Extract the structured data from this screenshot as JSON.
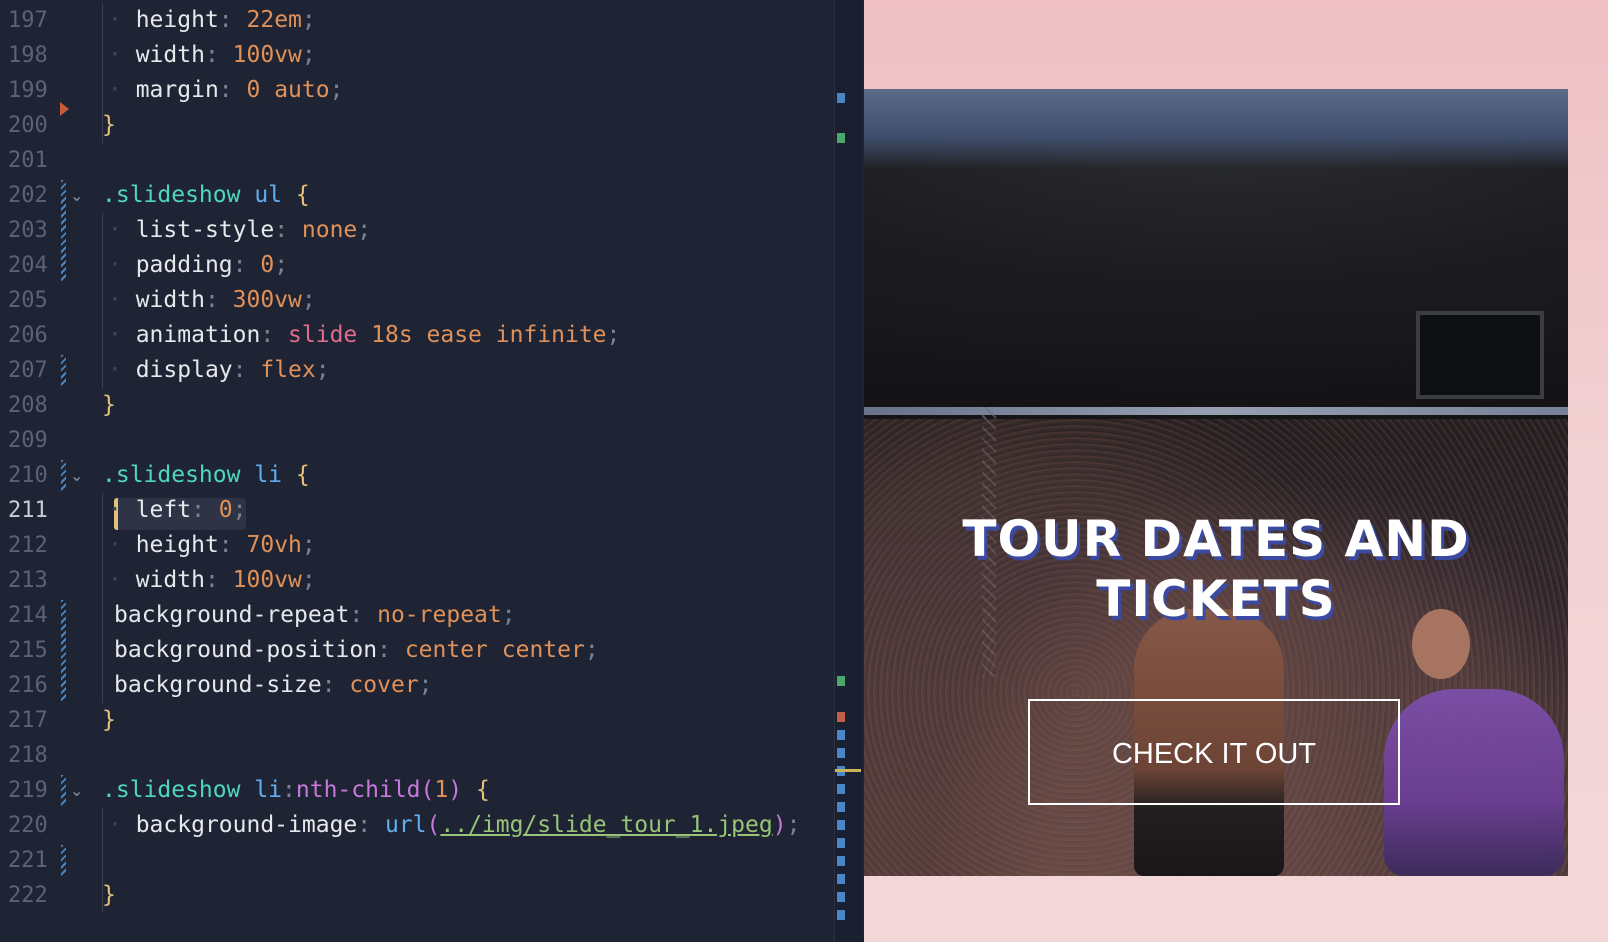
{
  "editor": {
    "lines": [
      {
        "n": "197",
        "tokens": [
          {
            "t": "height",
            "c": "prop"
          },
          {
            "t": ":",
            "c": "punc"
          },
          {
            "t": " 22em",
            "c": "num"
          },
          {
            "t": ";",
            "c": "punc"
          }
        ],
        "indent": 2
      },
      {
        "n": "198",
        "tokens": [
          {
            "t": "width",
            "c": "prop"
          },
          {
            "t": ":",
            "c": "punc"
          },
          {
            "t": " 100vw",
            "c": "num"
          },
          {
            "t": ";",
            "c": "punc"
          }
        ],
        "indent": 2
      },
      {
        "n": "199",
        "tokens": [
          {
            "t": "margin",
            "c": "prop"
          },
          {
            "t": ":",
            "c": "punc"
          },
          {
            "t": " 0 auto",
            "c": "num"
          },
          {
            "t": ";",
            "c": "punc"
          }
        ],
        "indent": 2
      },
      {
        "n": "200",
        "tokens": [
          {
            "t": "}",
            "c": "brace"
          }
        ],
        "indent": 1
      },
      {
        "n": "201",
        "tokens": [],
        "indent": 0
      },
      {
        "n": "202",
        "tokens": [
          {
            "t": ".slideshow",
            "c": "sel"
          },
          {
            "t": " ul",
            "c": "tag"
          },
          {
            "t": " {",
            "c": "brace"
          }
        ],
        "indent": 0,
        "fold": true
      },
      {
        "n": "203",
        "tokens": [
          {
            "t": "list-style",
            "c": "prop"
          },
          {
            "t": ":",
            "c": "punc"
          },
          {
            "t": " none",
            "c": "kw"
          },
          {
            "t": ";",
            "c": "punc"
          }
        ],
        "indent": 2
      },
      {
        "n": "204",
        "tokens": [
          {
            "t": "padding",
            "c": "prop"
          },
          {
            "t": ":",
            "c": "punc"
          },
          {
            "t": " 0",
            "c": "num"
          },
          {
            "t": ";",
            "c": "punc"
          }
        ],
        "indent": 2
      },
      {
        "n": "205",
        "tokens": [
          {
            "t": "width",
            "c": "prop"
          },
          {
            "t": ":",
            "c": "punc"
          },
          {
            "t": " 300vw",
            "c": "num"
          },
          {
            "t": ";",
            "c": "punc"
          }
        ],
        "indent": 2
      },
      {
        "n": "206",
        "tokens": [
          {
            "t": "animation",
            "c": "prop"
          },
          {
            "t": ":",
            "c": "punc"
          },
          {
            "t": " slide",
            "c": "anim"
          },
          {
            "t": " 18s ease infinite",
            "c": "kw"
          },
          {
            "t": ";",
            "c": "punc"
          }
        ],
        "indent": 2
      },
      {
        "n": "207",
        "tokens": [
          {
            "t": "display",
            "c": "prop"
          },
          {
            "t": ":",
            "c": "punc"
          },
          {
            "t": " flex",
            "c": "kw"
          },
          {
            "t": ";",
            "c": "punc"
          }
        ],
        "indent": 2
      },
      {
        "n": "208",
        "tokens": [
          {
            "t": "}",
            "c": "brace"
          }
        ],
        "indent": 1
      },
      {
        "n": "209",
        "tokens": [],
        "indent": 0
      },
      {
        "n": "210",
        "tokens": [
          {
            "t": ".slideshow",
            "c": "sel"
          },
          {
            "t": " li",
            "c": "tag"
          },
          {
            "t": " {",
            "c": "brace"
          }
        ],
        "indent": 0,
        "fold": true
      },
      {
        "n": "211",
        "tokens": [
          {
            "t": "left",
            "c": "prop"
          },
          {
            "t": ":",
            "c": "punc"
          },
          {
            "t": " 0",
            "c": "num"
          },
          {
            "t": ";",
            "c": "punc"
          }
        ],
        "indent": 2,
        "current": true
      },
      {
        "n": "212",
        "tokens": [
          {
            "t": "height",
            "c": "prop"
          },
          {
            "t": ":",
            "c": "punc"
          },
          {
            "t": " 70vh",
            "c": "num"
          },
          {
            "t": ";",
            "c": "punc"
          }
        ],
        "indent": 2
      },
      {
        "n": "213",
        "tokens": [
          {
            "t": "width",
            "c": "prop"
          },
          {
            "t": ":",
            "c": "punc"
          },
          {
            "t": " 100vw",
            "c": "num"
          },
          {
            "t": ";",
            "c": "punc"
          }
        ],
        "indent": 2
      },
      {
        "n": "214",
        "tokens": [
          {
            "t": "background-repeat",
            "c": "prop"
          },
          {
            "t": ":",
            "c": "punc"
          },
          {
            "t": " no-repeat",
            "c": "kw"
          },
          {
            "t": ";",
            "c": "punc"
          }
        ],
        "indent": 1.5
      },
      {
        "n": "215",
        "tokens": [
          {
            "t": "background-position",
            "c": "prop"
          },
          {
            "t": ":",
            "c": "punc"
          },
          {
            "t": " center center",
            "c": "kw"
          },
          {
            "t": ";",
            "c": "punc"
          }
        ],
        "indent": 1.5
      },
      {
        "n": "216",
        "tokens": [
          {
            "t": "background-size",
            "c": "prop"
          },
          {
            "t": ":",
            "c": "punc"
          },
          {
            "t": " cover",
            "c": "kw"
          },
          {
            "t": ";",
            "c": "punc"
          }
        ],
        "indent": 1.5
      },
      {
        "n": "217",
        "tokens": [
          {
            "t": "}",
            "c": "brace"
          }
        ],
        "indent": 1
      },
      {
        "n": "218",
        "tokens": [],
        "indent": 0
      },
      {
        "n": "219",
        "tokens": [
          {
            "t": ".slideshow",
            "c": "sel"
          },
          {
            "t": " li",
            "c": "tag"
          },
          {
            "t": ":",
            "c": "punc"
          },
          {
            "t": "nth-child",
            "c": "pseudo"
          },
          {
            "t": "(",
            "c": "paren"
          },
          {
            "t": "1",
            "c": "num"
          },
          {
            "t": ")",
            "c": "paren"
          },
          {
            "t": " {",
            "c": "brace"
          }
        ],
        "indent": 0,
        "fold": true
      },
      {
        "n": "220",
        "tokens": [
          {
            "t": "background-image",
            "c": "prop"
          },
          {
            "t": ":",
            "c": "punc"
          },
          {
            "t": " url",
            "c": "fn"
          },
          {
            "t": "(",
            "c": "paren"
          },
          {
            "t": "../img/slide_tour_1.jpeg",
            "c": "url"
          },
          {
            "t": ")",
            "c": "paren"
          },
          {
            "t": ";",
            "c": "punc"
          }
        ],
        "indent": 2
      },
      {
        "n": "221",
        "tokens": [],
        "indent": 0
      },
      {
        "n": "222",
        "tokens": [
          {
            "t": "}",
            "c": "brace"
          }
        ],
        "indent": 1
      }
    ],
    "fold_icon": "chevron-down-icon",
    "colors": {
      "background": "#1e2433",
      "selector": "#4fd6be",
      "number": "#e0915a",
      "brace": "#e5c07b",
      "url": "#98c379"
    }
  },
  "preview": {
    "title": "TOUR DATES AND TICKETS",
    "button_label": "CHECK IT OUT"
  }
}
